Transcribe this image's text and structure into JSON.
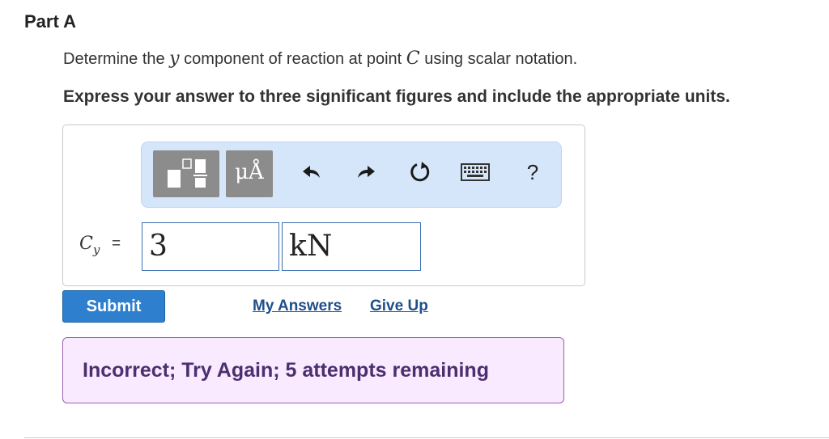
{
  "part": {
    "title": "Part A"
  },
  "question": {
    "prefix": "Determine the ",
    "var_y": "y",
    "middle": " component of reaction at point ",
    "var_c": "C",
    "suffix": " using scalar notation."
  },
  "instruction": "Express your answer to three significant figures and include the appropriate units.",
  "toolbar": {
    "units_label": "μÅ",
    "help_label": "?",
    "icons": [
      "templates-icon",
      "units-icon",
      "undo-icon",
      "redo-icon",
      "reset-icon",
      "keyboard-icon",
      "help-icon"
    ]
  },
  "answer": {
    "variable": "C",
    "variable_sub": "y",
    "equals": "=",
    "value": "3",
    "units": "kN"
  },
  "actions": {
    "submit_label": "Submit",
    "my_answers_label": "My Answers",
    "give_up_label": "Give Up"
  },
  "feedback": {
    "text": "Incorrect; Try Again; 5 attempts remaining"
  },
  "colors": {
    "submit_bg": "#2f7fcf",
    "link": "#1f4f8c",
    "toolbar_bg": "#d6e6fa",
    "feedback_bg": "#faeaff",
    "feedback_border": "#9c5fb5",
    "input_border": "#3a6fb0"
  }
}
